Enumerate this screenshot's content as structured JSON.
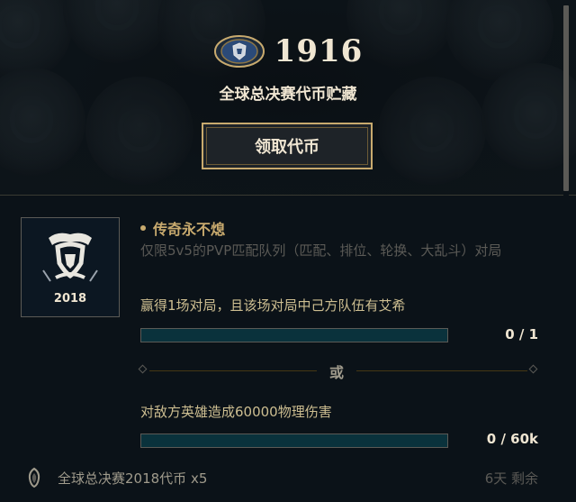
{
  "header": {
    "currency_amount": "1916",
    "currency_title": "全球总决赛代币贮藏",
    "claim_button_label": "领取代币",
    "token_icon": "worlds-token-icon"
  },
  "mission": {
    "art_year": "2018",
    "art_icon": "worlds-trophy-emblem",
    "title": "传奇永不熄",
    "description": "仅限5v5的PVP匹配队列（匹配、排位、轮换、大乱斗）对局",
    "objectives": [
      {
        "text": "赢得1场对局，且该场对局中己方队伍有艾希",
        "progress_label": "0 / 1",
        "progress_fraction": 0
      },
      {
        "text": "对敌方英雄造成60000物理伤害",
        "progress_label": "0 / 60k",
        "progress_fraction": 0
      }
    ],
    "or_label": "或"
  },
  "reward": {
    "icon": "token-reward-icon",
    "text": "全球总决赛2018代币 x5",
    "time_remaining": "6天 剩余"
  },
  "colors": {
    "gold": "#c8aa6e",
    "cream": "#f0e6d2",
    "muted": "#5b5a56",
    "progress_track": "#0a323c",
    "progress_fill": "#0ac8b9",
    "background": "#0b1218"
  }
}
